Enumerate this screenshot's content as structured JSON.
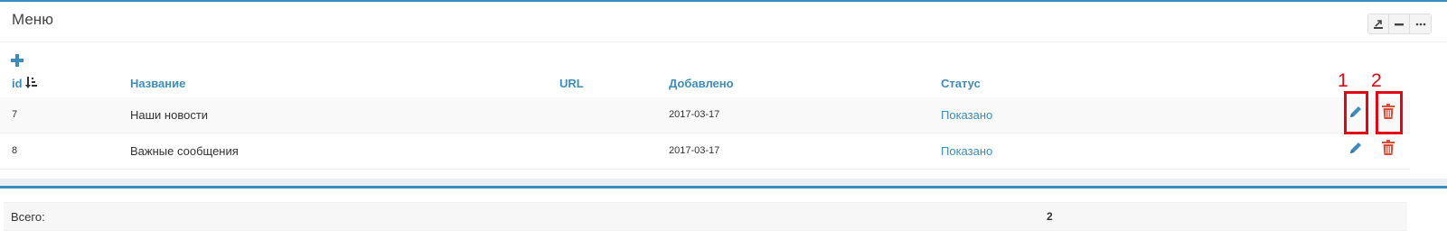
{
  "panel": {
    "title": "Меню",
    "tools": [
      {
        "icon": "export-icon"
      },
      {
        "icon": "minus-icon"
      },
      {
        "icon": "more-icon"
      }
    ]
  },
  "colors": {
    "accent": "#3c8dbc",
    "danger": "#dd4b39",
    "highlight": "#e30613"
  },
  "table": {
    "columns": [
      "id",
      "Название",
      "URL",
      "Добавлено",
      "Статус"
    ],
    "rows": [
      {
        "id": "7",
        "name": "Наши новости",
        "url": "",
        "added": "2017-03-17",
        "status": "Показано"
      },
      {
        "id": "8",
        "name": "Важные сообщения",
        "url": "",
        "added": "2017-03-17",
        "status": "Показано"
      }
    ]
  },
  "annotations": [
    "1",
    "2"
  ],
  "footer": {
    "label": "Всего:",
    "value": "2"
  }
}
